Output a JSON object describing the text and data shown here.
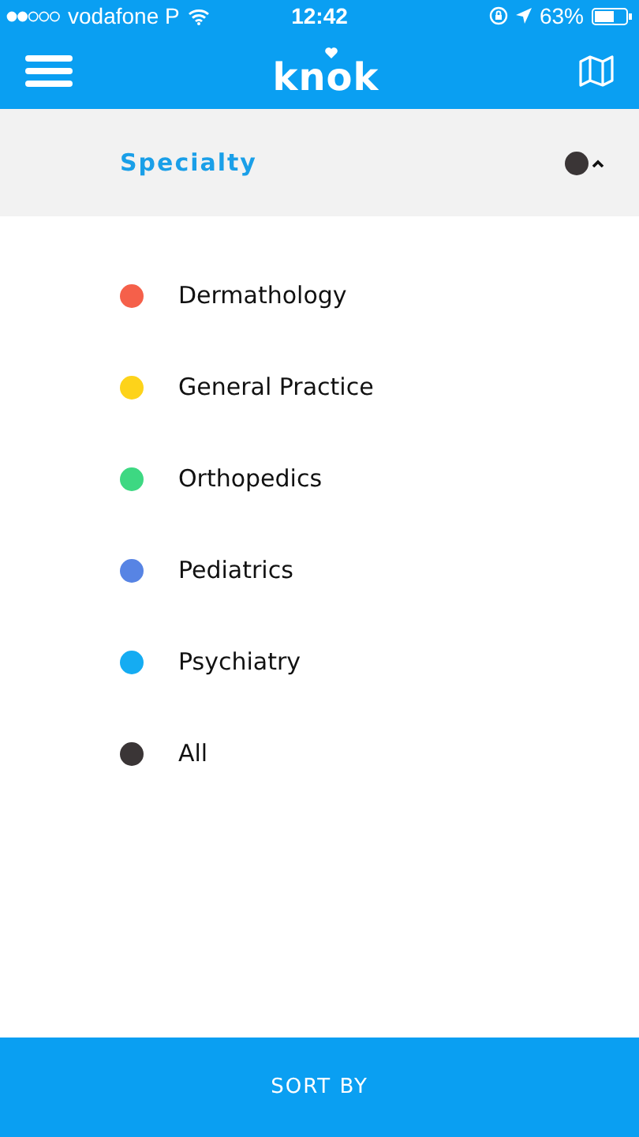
{
  "status_bar": {
    "carrier": "vodafone P",
    "time": "12:42",
    "battery": "63%"
  },
  "header": {
    "logo": "knok"
  },
  "filter": {
    "title": "Specialty",
    "color": "#3a3536",
    "expanded": true
  },
  "items": [
    {
      "label": "Dermathology",
      "color": "#f5604a"
    },
    {
      "label": "General Practice",
      "color": "#fdd31a"
    },
    {
      "label": "Orthopedics",
      "color": "#3dd882"
    },
    {
      "label": "Pediatrics",
      "color": "#5784e4"
    },
    {
      "label": "Psychiatry",
      "color": "#15acf2"
    },
    {
      "label": "All",
      "color": "#3a3536"
    }
  ],
  "footer": {
    "button": "SORT BY"
  }
}
